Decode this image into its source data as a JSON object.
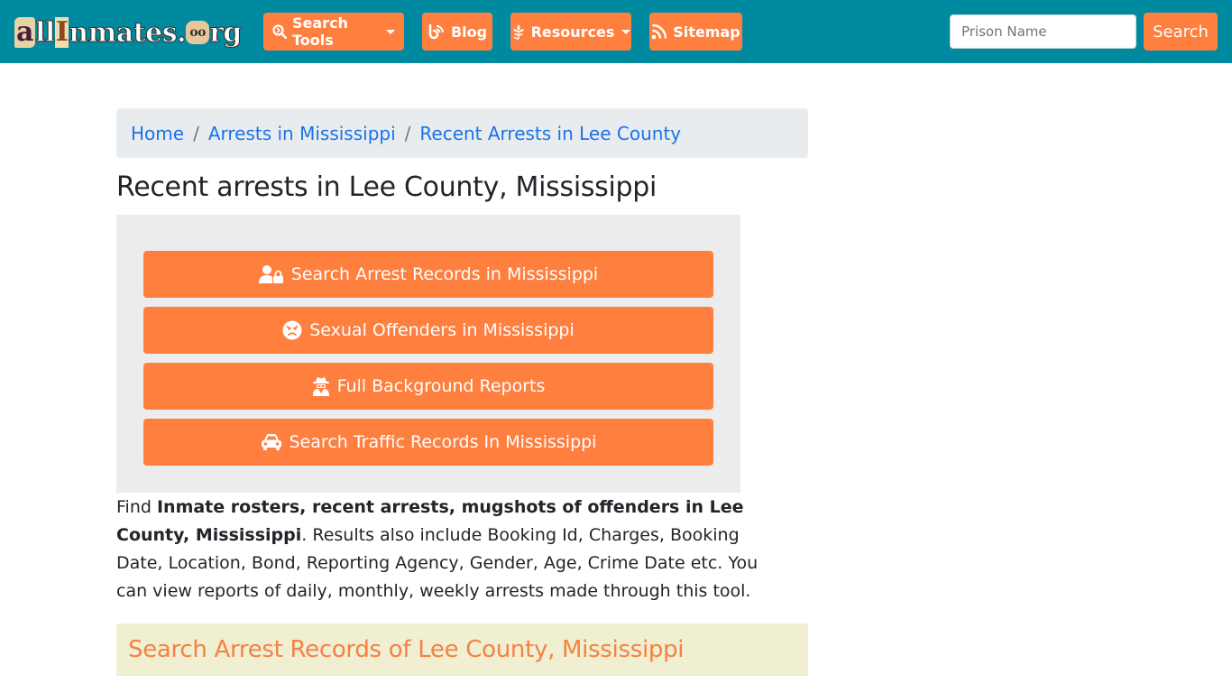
{
  "navbar": {
    "logo": {
      "part_a": "a",
      "part_ll": "ll",
      "part_i": "I",
      "part_rest": "nmates.",
      "part_o": "oo",
      "part_rg": "rg",
      "alt": "allInmates.org"
    },
    "items": [
      {
        "label": "Search Tools",
        "icon": "search-icon",
        "dropdown": true
      },
      {
        "label": "Blog",
        "icon": "blog-icon",
        "dropdown": false
      },
      {
        "label": "Resources",
        "icon": "leaf-icon",
        "dropdown": true
      },
      {
        "label": "Sitemap",
        "icon": "rss-icon",
        "dropdown": false
      }
    ],
    "search": {
      "placeholder": "Prison Name",
      "value": "",
      "button_label": "Search"
    }
  },
  "breadcrumb": {
    "items": [
      {
        "label": "Home"
      },
      {
        "label": "Arrests in Mississippi"
      },
      {
        "label": "Recent Arrests in Lee County"
      }
    ],
    "separator": "/"
  },
  "page_title": "Recent arrests in Lee County, Mississippi",
  "action_buttons": [
    {
      "label": "Search Arrest Records in Mississippi",
      "icon": "user-lock-icon"
    },
    {
      "label": "Sexual Offenders in Mississippi",
      "icon": "angry-face-icon"
    },
    {
      "label": "Full Background Reports",
      "icon": "user-secret-icon"
    },
    {
      "label": "Search Traffic Records In Mississippi",
      "icon": "car-icon"
    }
  ],
  "intro": {
    "prefix": "Find ",
    "bold": "Inmate rosters, recent arrests, mugshots of offenders in Lee County, Mississippi",
    "suffix": ". Results also include Booking Id, Charges, Booking Date, Location, Bond, Reporting Agency, Gender, Age, Crime Date etc. You can view reports of daily, monthly, weekly arrests made through this tool."
  },
  "section_header": "Search Arrest Records of Lee County, Mississippi",
  "colors": {
    "navbar_bg": "#008aa0",
    "accent_orange": "#ff7f3f",
    "link_blue": "#1a73e8",
    "section_bg": "#f0efd2",
    "section_text": "#f58143"
  }
}
